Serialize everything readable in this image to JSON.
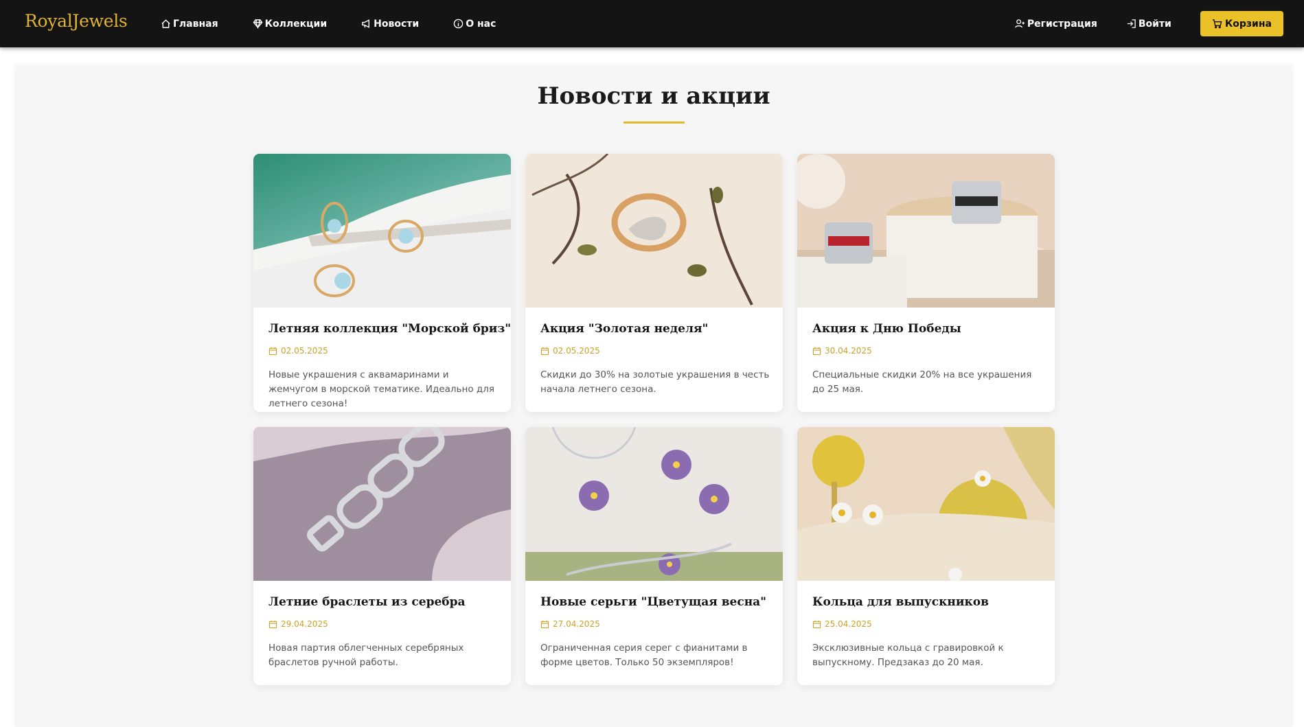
{
  "brand": "RoyalJewels",
  "nav": {
    "home": "Главная",
    "collections": "Коллекции",
    "news": "Новости",
    "about": "О нас",
    "register": "Регистрация",
    "login": "Войти",
    "cart": "Корзина"
  },
  "icons": {
    "home": "home-icon",
    "collections": "diamond-icon",
    "news": "megaphone-icon",
    "about": "info-icon",
    "register": "user-plus-icon",
    "login": "login-icon",
    "cart": "cart-icon",
    "date": "calendar-icon"
  },
  "colors": {
    "navbar": "#141414",
    "accent": "#ebc12a",
    "brand": "#e2b32e",
    "date": "#c9a227"
  },
  "page": {
    "title": "Новости и акции"
  },
  "news": [
    {
      "title": "Летняя коллекция \"Морской бриз\"",
      "date": "02.05.2025",
      "text": "Новые украшения с аквамаринами и жемчугом в морской тематике. Идеально для летнего сезона!"
    },
    {
      "title": "Акция \"Золотая неделя\"",
      "date": "02.05.2025",
      "text": "Скидки до 30% на золотые украшения в честь начала летнего сезона."
    },
    {
      "title": "Акция к Дню Победы",
      "date": "30.04.2025",
      "text": "Специальные скидки 20% на все украшения до 25 мая."
    },
    {
      "title": "Летние браслеты из серебра",
      "date": "29.04.2025",
      "text": "Новая партия облегченных серебряных браслетов ручной работы."
    },
    {
      "title": "Новые серьги \"Цветущая весна\"",
      "date": "27.04.2025",
      "text": "Ограниченная серия серег с фианитами в форме цветов. Только 50 экземпляров!"
    },
    {
      "title": "Кольца для выпускников",
      "date": "25.04.2025",
      "text": "Эксклюзивные кольца с гравировкой к выпускному. Предзаказ до 20 мая."
    }
  ]
}
